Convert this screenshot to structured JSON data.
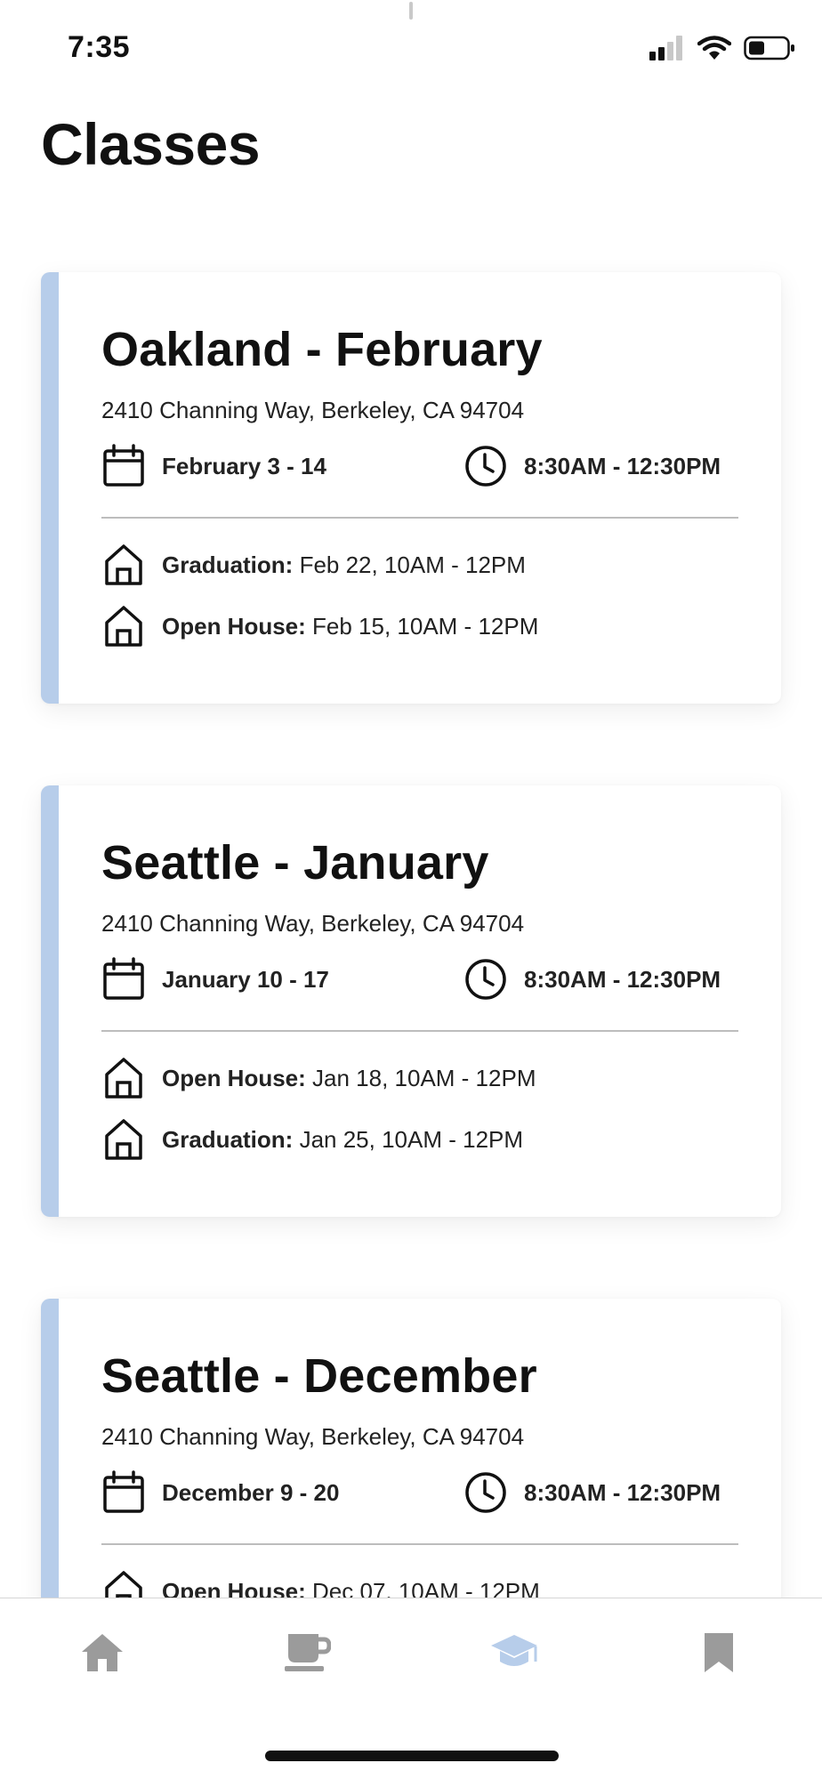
{
  "status_bar": {
    "time": "7:35",
    "icons": [
      "signal-icon",
      "wifi-icon",
      "battery-icon"
    ]
  },
  "page": {
    "title": "Classes"
  },
  "colors": {
    "accent": "#b7cdea",
    "tab_active": "#b7cdea",
    "tab_inactive": "#9b9b9b"
  },
  "classes": [
    {
      "title": "Oakland - February",
      "address": "2410 Channing Way, Berkeley, CA 94704",
      "dates": "February 3 - 14",
      "time": "8:30AM - 12:30PM",
      "events": [
        {
          "label": "Graduation:",
          "value": " Feb 22, 10AM - 12PM"
        },
        {
          "label": "Open House:",
          "value": " Feb 15, 10AM - 12PM"
        }
      ]
    },
    {
      "title": "Seattle - January",
      "address": "2410 Channing Way, Berkeley, CA 94704",
      "dates": "January 10 - 17",
      "time": "8:30AM - 12:30PM",
      "events": [
        {
          "label": "Open House:",
          "value": " Jan 18, 10AM - 12PM"
        },
        {
          "label": "Graduation:",
          "value": " Jan 25, 10AM - 12PM"
        }
      ]
    },
    {
      "title": "Seattle - December",
      "address": "2410 Channing Way, Berkeley, CA 94704",
      "dates": "December 9 - 20",
      "time": "8:30AM - 12:30PM",
      "events": [
        {
          "label": "Open House:",
          "value": " Dec 07, 10AM - 12PM"
        }
      ]
    }
  ],
  "tab_bar": {
    "tabs": [
      {
        "icon": "home-icon",
        "active": false
      },
      {
        "icon": "coffee-cup-icon",
        "active": false
      },
      {
        "icon": "graduation-cap-icon",
        "active": true
      },
      {
        "icon": "bookmark-icon",
        "active": false
      }
    ]
  }
}
